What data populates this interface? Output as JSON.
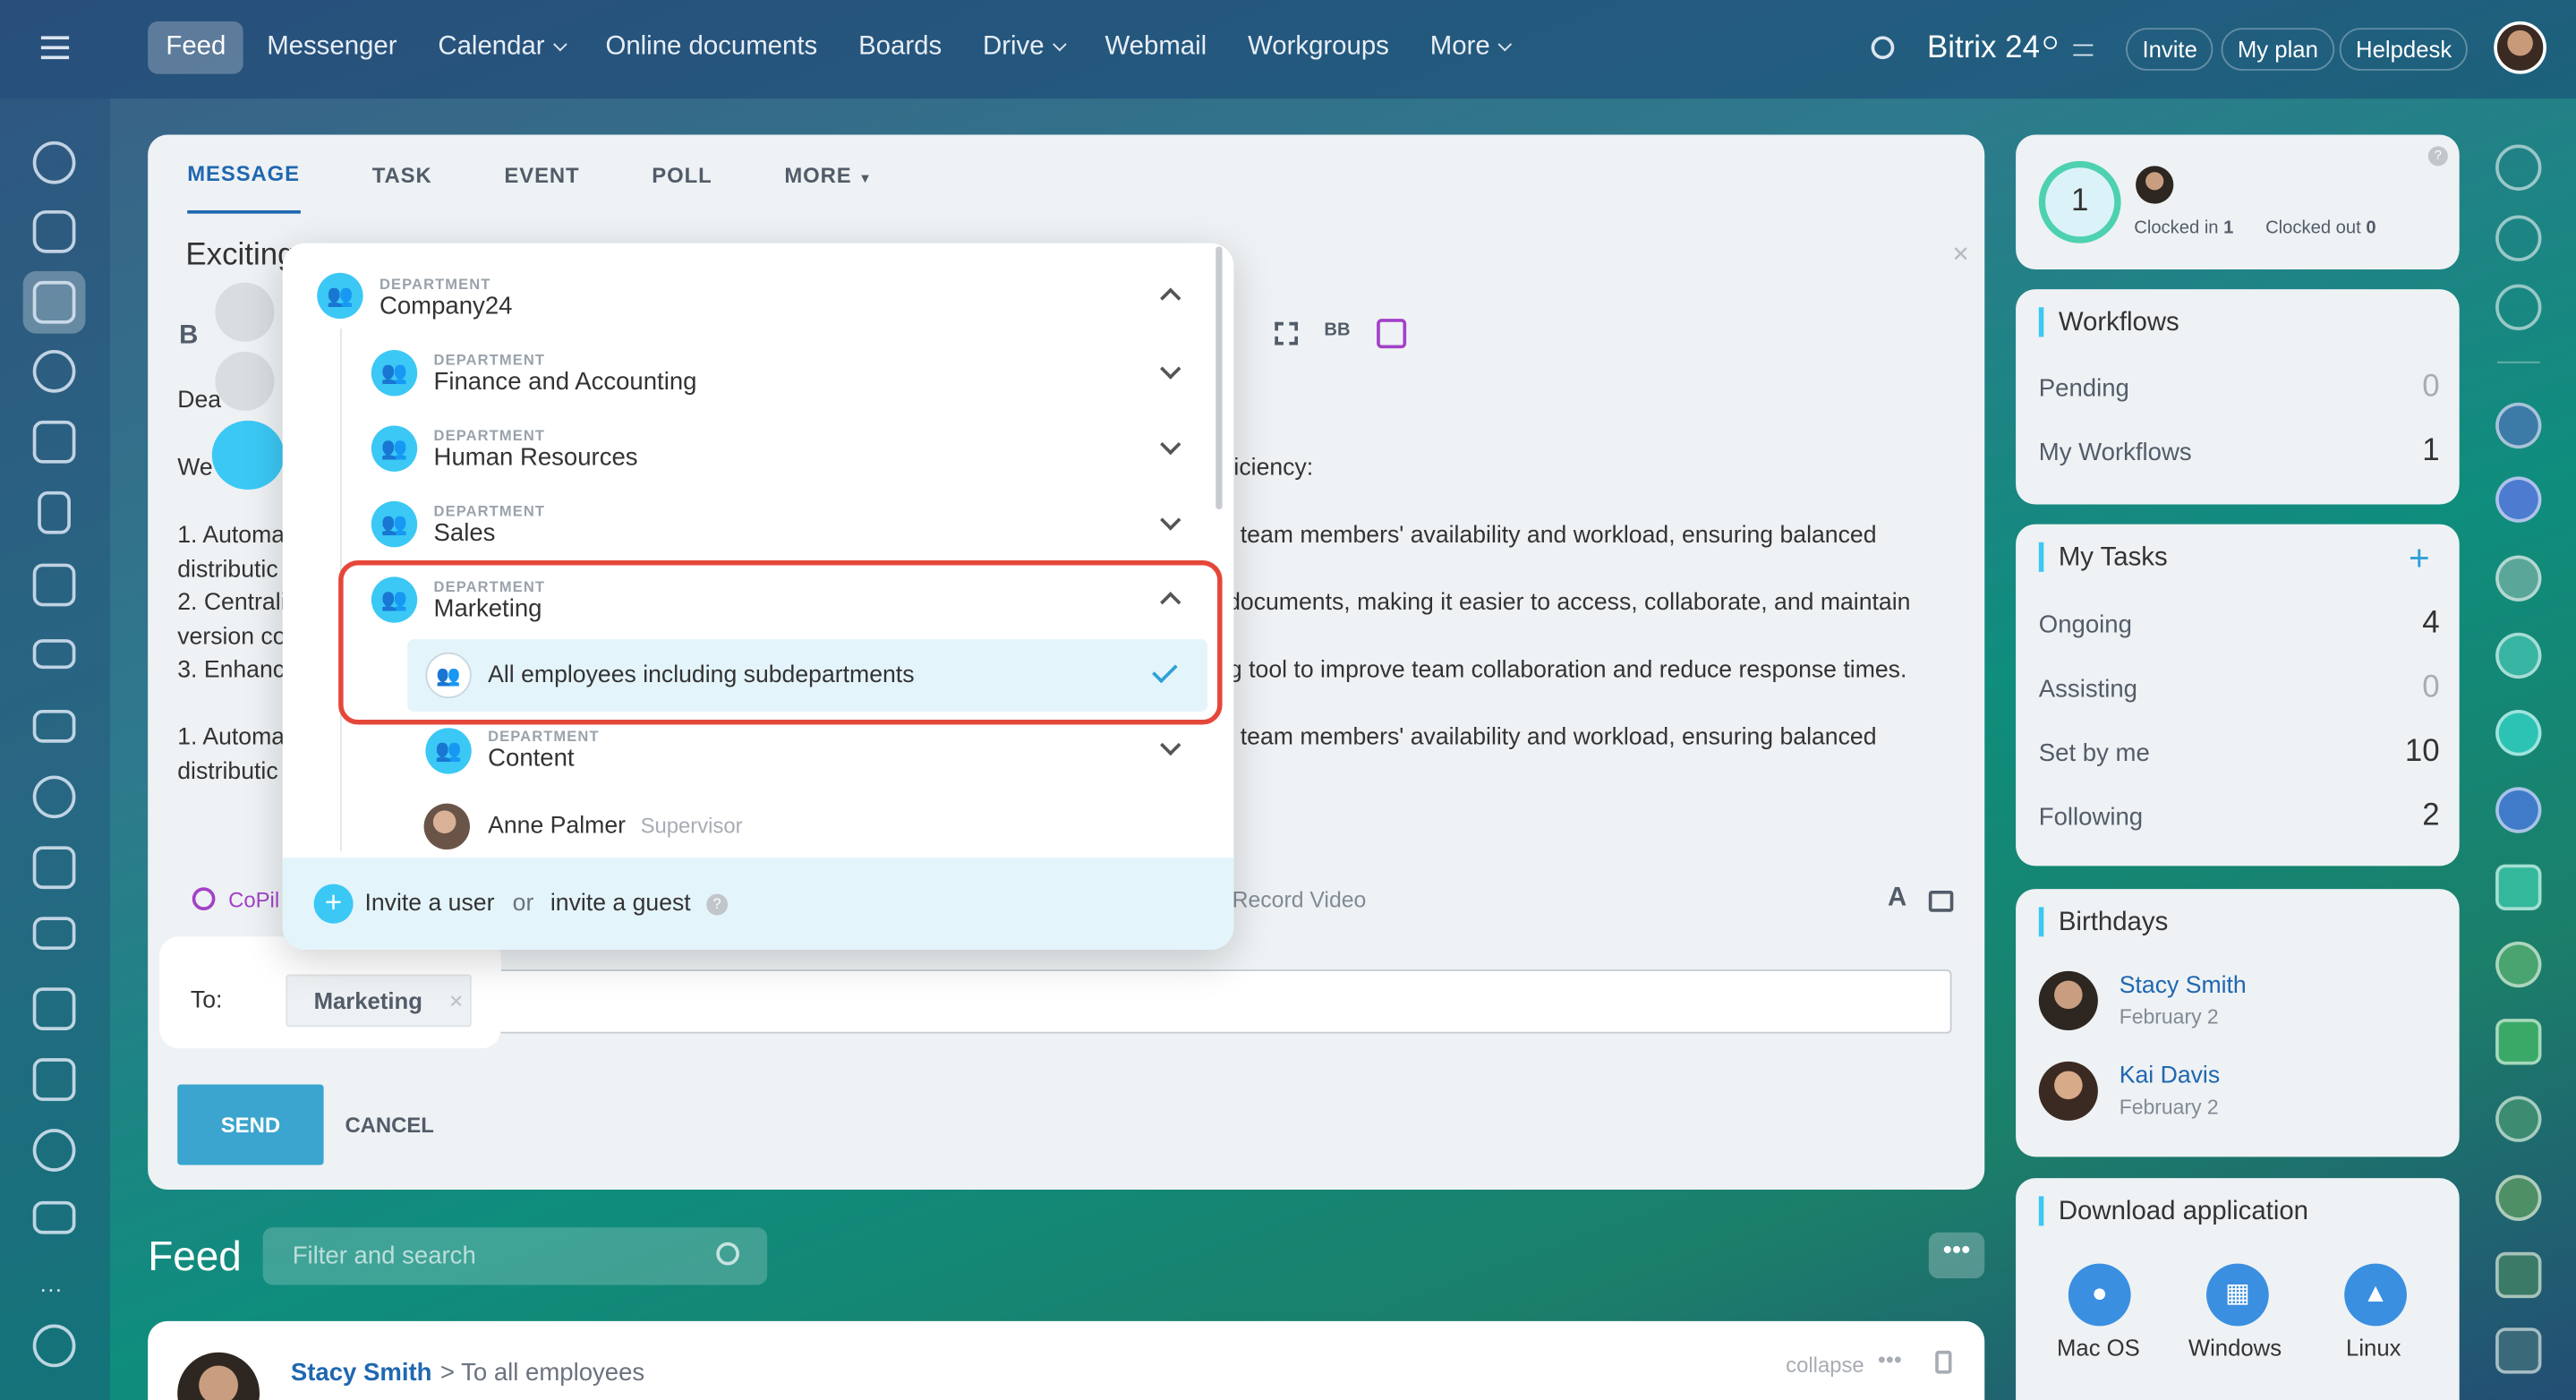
{
  "nav": {
    "items": [
      "Feed",
      "Messenger",
      "Calendar",
      "Online documents",
      "Boards",
      "Drive",
      "Webmail",
      "Workgroups",
      "More"
    ],
    "brand": "Bitrix 24",
    "invite": "Invite",
    "my_plan": "My plan",
    "helpdesk": "Helpdesk"
  },
  "composer": {
    "tabs": [
      "MESSAGE",
      "TASK",
      "EVENT",
      "POLL",
      "MORE"
    ],
    "title_fragment": "Exciting",
    "body_fragments": {
      "dear": "Dea",
      "we": "We",
      "l1": "1. Automa",
      "l1b": "distributic",
      "l2": "2. Centrali",
      "l2b": "version co",
      "l3": "3. Enhanc",
      "l4": "1. Automa",
      "l4b": "distributic",
      "r0": "iciency:",
      "r1": "team members' availability and workload, ensuring balanced",
      "r2": "documents, making it easier to access, collaborate, and maintain",
      "r3": "g tool to improve team collaboration and reduce response times.",
      "r4": "team members' availability and workload, ensuring balanced"
    },
    "copilot": "CoPil",
    "record_video": "Record Video",
    "to_label": "To:",
    "recipient": "Marketing",
    "send": "SEND",
    "cancel": "CANCEL"
  },
  "dropdown": {
    "dept_label": "DEPARTMENT",
    "root": "Company24",
    "items": [
      {
        "name": "Finance and Accounting"
      },
      {
        "name": "Human Resources"
      },
      {
        "name": "Sales"
      },
      {
        "name": "Marketing"
      }
    ],
    "all_employees": "All employees including subdepartments",
    "content": "Content",
    "person": {
      "name": "Anne Palmer",
      "role": "Supervisor"
    },
    "invite_user": "Invite a user",
    "or": "or",
    "invite_guest": "invite a guest"
  },
  "feed": {
    "title": "Feed",
    "search_placeholder": "Filter and search",
    "post_author": "Stacy Smith",
    "post_target": "To all employees",
    "collapse": "collapse"
  },
  "sidebar_right": {
    "clock": {
      "value": "1",
      "clocked_in": "Clocked in",
      "clocked_in_n": "1",
      "clocked_out": "Clocked out",
      "clocked_out_n": "0"
    },
    "workflows": {
      "title": "Workflows",
      "rows": [
        {
          "label": "Pending",
          "value": "0"
        },
        {
          "label": "My Workflows",
          "value": "1"
        }
      ]
    },
    "tasks": {
      "title": "My Tasks",
      "rows": [
        {
          "label": "Ongoing",
          "value": "4"
        },
        {
          "label": "Assisting",
          "value": "0"
        },
        {
          "label": "Set by me",
          "value": "10"
        },
        {
          "label": "Following",
          "value": "2"
        }
      ]
    },
    "birthdays": {
      "title": "Birthdays",
      "people": [
        {
          "name": "Stacy Smith",
          "date": "February 2"
        },
        {
          "name": "Kai Davis",
          "date": "February 2"
        }
      ]
    },
    "download": {
      "title": "Download application",
      "apps": [
        "Mac OS",
        "Windows",
        "Linux"
      ]
    }
  },
  "colors": {
    "accent": "#3bc8f5",
    "highlight_border": "#e5473a",
    "send": "#3ba5cf",
    "link": "#2067b0"
  }
}
